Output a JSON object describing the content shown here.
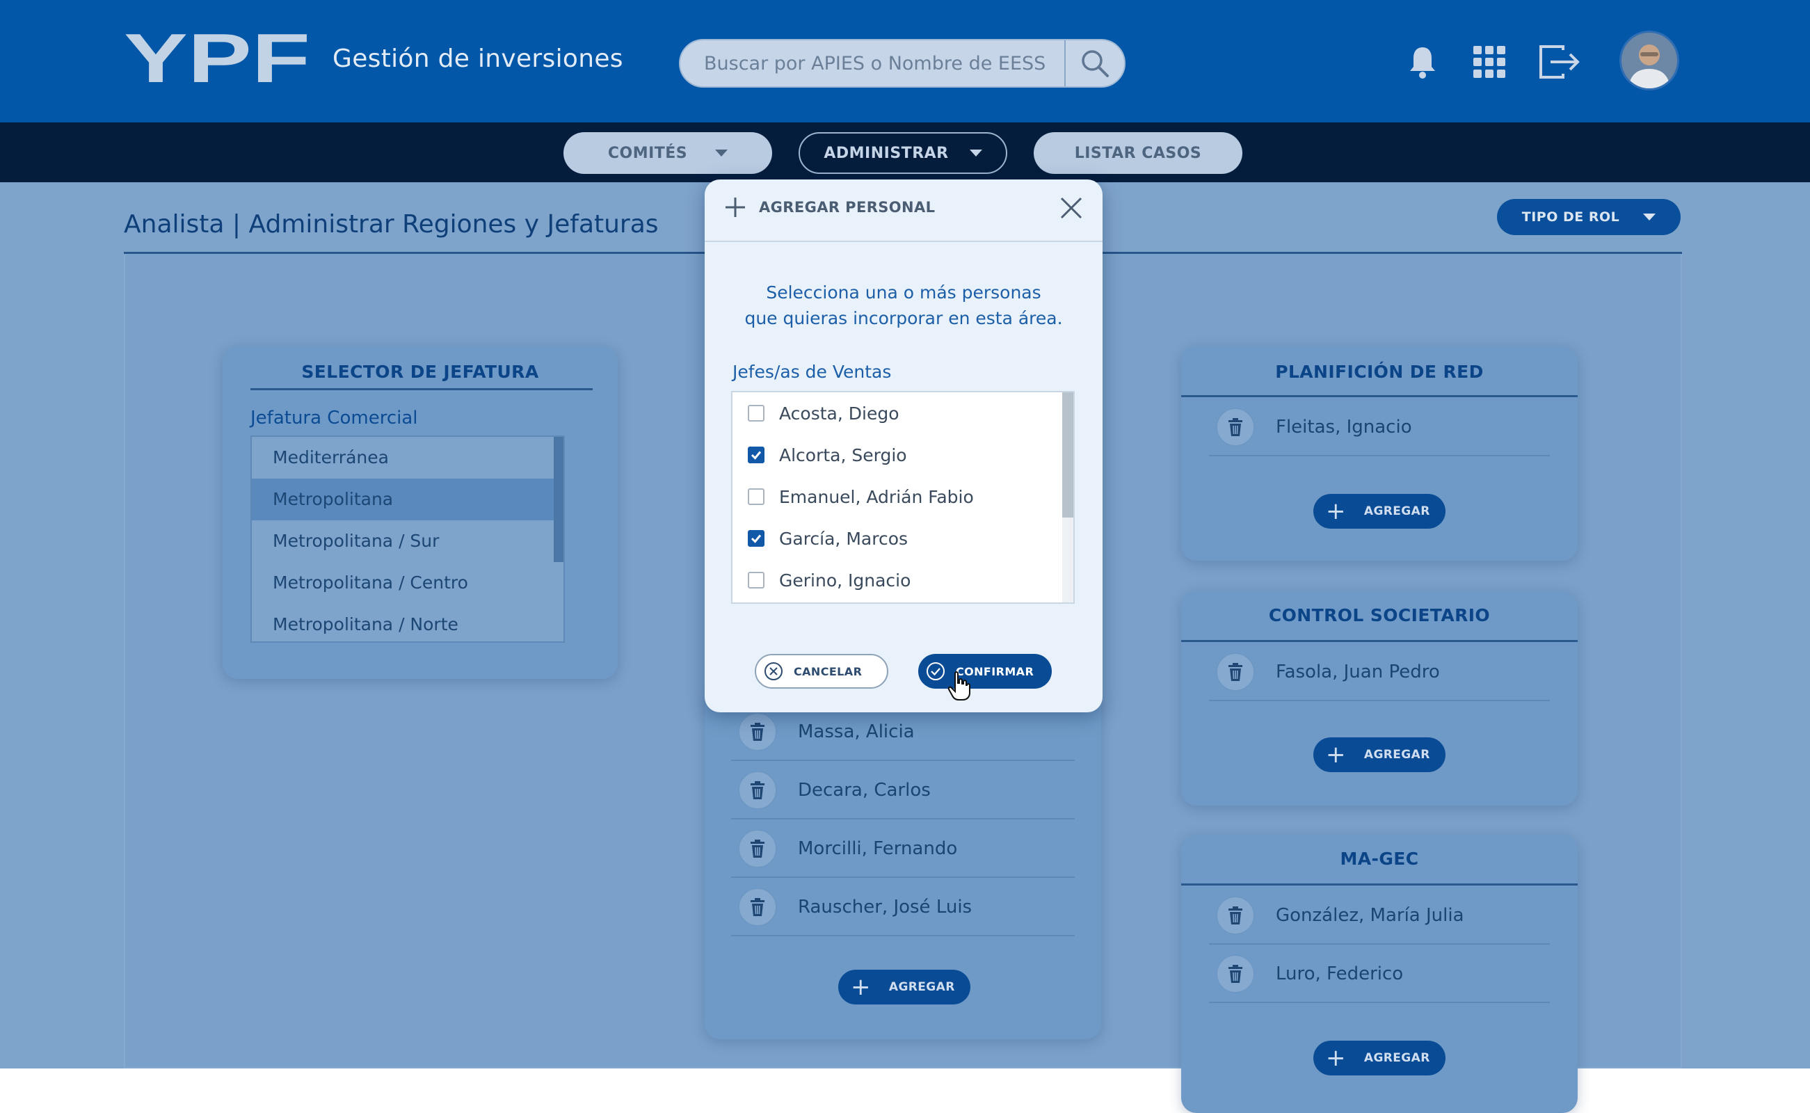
{
  "header": {
    "logo_text": "YPF",
    "app_title": "Gestión de inversiones",
    "search_placeholder": "Buscar por APIES o Nombre de EESS",
    "icons": [
      "search-icon",
      "bell-icon",
      "apps-grid-icon",
      "logout-icon"
    ]
  },
  "nav": {
    "comites": "COMITÉS",
    "administrar": "ADMINISTRAR",
    "listar": "LISTAR CASOS"
  },
  "page": {
    "title": "Analista | Administrar Regiones y Jefaturas",
    "tipo_rol": "TIPO DE ROL"
  },
  "selector": {
    "title": "SELECTOR DE JEFATURA",
    "subtitle": "Jefatura Comercial",
    "items": [
      {
        "label": "Mediterránea",
        "selected": false
      },
      {
        "label": "Metropolitana",
        "selected": true
      },
      {
        "label": "Metropolitana / Sur",
        "selected": false
      },
      {
        "label": "Metropolitana / Centro",
        "selected": false
      },
      {
        "label": "Metropolitana / Norte",
        "selected": false
      }
    ]
  },
  "middle_card": {
    "people": [
      "Massa, Alicia",
      "Decara, Carlos",
      "Morcilli, Fernando",
      "Rauscher, José Luis"
    ],
    "add_label": "AGREGAR"
  },
  "right_cards": [
    {
      "title": "PLANIFICIÓN DE RED",
      "people": [
        "Fleitas, Ignacio"
      ],
      "add_label": "AGREGAR"
    },
    {
      "title": "CONTROL SOCIETARIO",
      "people": [
        "Fasola, Juan Pedro"
      ],
      "add_label": "AGREGAR"
    },
    {
      "title": "MA-GEC",
      "people": [
        "González, María Julia",
        "Luro, Federico"
      ],
      "add_label": "AGREGAR"
    }
  ],
  "modal": {
    "title": "AGREGAR PERSONAL",
    "description_line1": "Selecciona una o más personas",
    "description_line2": "que quieras incorporar en esta área.",
    "list_label": "Jefes/as de Ventas",
    "options": [
      {
        "label": "Acosta, Diego",
        "checked": false
      },
      {
        "label": "Alcorta, Sergio",
        "checked": true
      },
      {
        "label": "Emanuel, Adrián Fabio",
        "checked": false
      },
      {
        "label": "García, Marcos",
        "checked": true
      },
      {
        "label": "Gerino, Ignacio",
        "checked": false
      }
    ],
    "cancel_label": "CANCELAR",
    "confirm_label": "CONFIRMAR"
  },
  "colors": {
    "header_blue": "#0257a8",
    "navbar_dark": "#041d3d",
    "accent_blue": "#0a4b96",
    "overlay_bg": "#7ea4cc"
  }
}
